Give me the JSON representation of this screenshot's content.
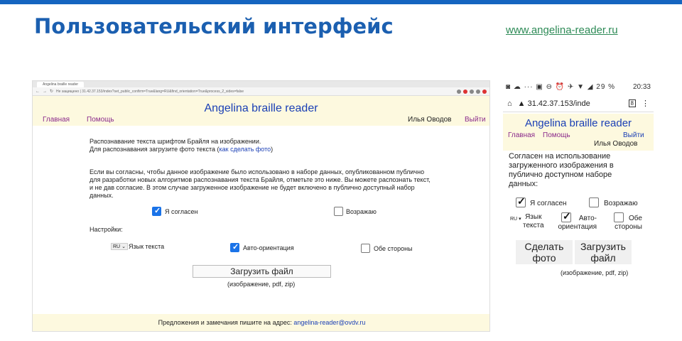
{
  "slide": {
    "title": "Пользовательский интерфейс",
    "site_link": "www.angelina-reader.ru",
    "accent_color": "#1565c0"
  },
  "desktop": {
    "tab_title": "Angelina braille reader",
    "url": "Не защищено | 31.42.37.153/index?set_public_confirm=True&lang=RU&find_orientation=True&process_2_sides=false",
    "header": {
      "title": "Angelina braille reader",
      "nav_main": "Главная",
      "nav_help": "Помощь",
      "user": "Илья Оводов",
      "logout": "Выйти"
    },
    "intro_line1": "Распознавание текста шрифтом Брайля на изображении.",
    "intro_line2": "Для распознавания загрузите фото текста (",
    "intro_link": "как сделать фото",
    "intro_close": ")",
    "consent_line1": "Если вы согласны, чтобы данное изображение было использовано в наборе данных, опубликованном публично",
    "consent_line2": "для разработки новых алгоритмов распознавания текста Брайля, отметьте это ниже. Вы можете распознать текст,",
    "consent_line3": "и не дав согласие. В этом случае загруженное изображение не будет включено в публично доступный набор",
    "consent_line4": "данных.",
    "agree_label": "Я согласен",
    "agree_checked": true,
    "object_label": "Возражаю",
    "object_checked": false,
    "settings_label": "Настройки:",
    "lang_value": "RU",
    "lang_label": "Язык текста",
    "auto_orient_label": "Авто-ориентация",
    "auto_orient_checked": true,
    "both_sides_label": "Обе стороны",
    "both_sides_checked": false,
    "upload_button": "Загрузить файл",
    "upload_hint": "(изображение, pdf, zip)",
    "footer_text": "Предложения и замечания пишите на адрес: ",
    "footer_email": "angelina-reader@ovdv.ru"
  },
  "mobile": {
    "status_left": "◙ ☁ ··· ▣ ⊖ ⏰ ✈ ▼ ◢ 29 %",
    "status_time": "20:33",
    "url": "31.42.37.153/inde",
    "tab_count": "8",
    "header": {
      "title": "Angelina braille reader",
      "nav_main": "Главная",
      "nav_help": "Помощь",
      "logout": "Выйти",
      "user": "Илья Оводов"
    },
    "consent_line1": "Согласен на использование",
    "consent_line2": "загруженного изображения в",
    "consent_line3": "публично доступном наборе",
    "consent_line4": "данных:",
    "agree_label": "Я согласен",
    "object_label": "Возражаю",
    "lang_value": "RU",
    "lang_label_1": "Язык",
    "lang_label_2": "текста",
    "auto_label_1": "Авто-",
    "auto_label_2": "ориентация",
    "both_label_1": "Обе",
    "both_label_2": "стороны",
    "photo_button_1": "Сделать",
    "photo_button_2": "фото",
    "upload_button_1": "Загрузить",
    "upload_button_2": "файл",
    "upload_hint": "(изображение, pdf, zip)"
  }
}
